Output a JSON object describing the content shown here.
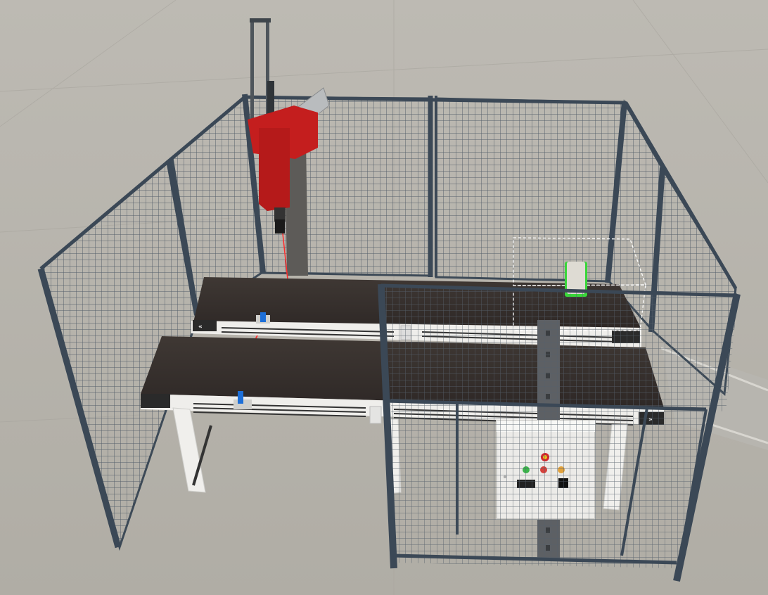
{
  "scene": {
    "conveyor_back_direction_label": "«",
    "conveyor_front_direction_label": "»"
  },
  "colors": {
    "floor": "#b9b6ae",
    "fence_post": "#3d4a57",
    "fence_mesh": "#4a5560",
    "belt": "#3a3330",
    "conveyor_frame": "#f1f1ef",
    "pick_and_place_body": "#c21d1d",
    "laser": "#ff2a2a",
    "sensor": "#1d6fd8",
    "part_highlight": "#39d63a",
    "control_panel": "#ececea"
  },
  "control_panel": {
    "emergency_stop": "emergency-stop",
    "indicator_lights": [
      "green",
      "red",
      "orange"
    ],
    "display": "digital-display",
    "selector_switch": "key-selector"
  }
}
